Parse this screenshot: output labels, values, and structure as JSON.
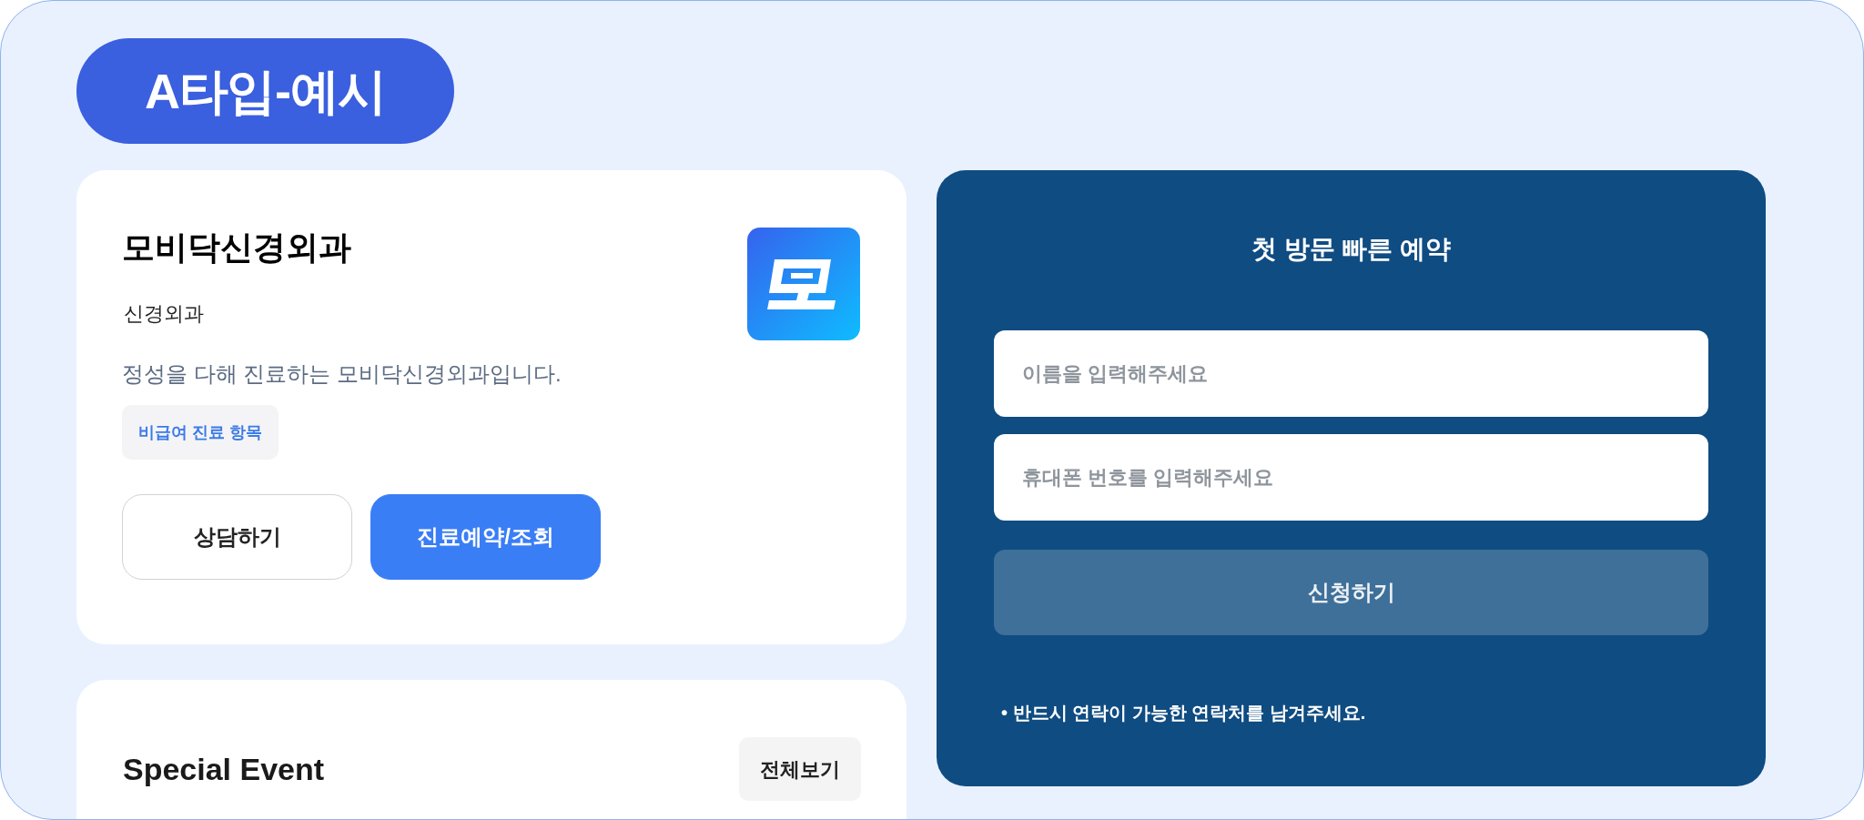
{
  "badge": {
    "label": "A타입-예시"
  },
  "clinic_card": {
    "name": "모비닥신경외과",
    "department": "신경외과",
    "description": "정성을 다해 진료하는 모비닥신경외과입니다.",
    "tags": [
      "비급여 진료 항목"
    ],
    "buttons": [
      {
        "label": "상담하기",
        "kind": "outline"
      },
      {
        "label": "진료예약/조회",
        "kind": "primary"
      }
    ]
  },
  "event_card": {
    "title": "Special Event",
    "view_all": "전체보기"
  },
  "reservation": {
    "title": "첫 방문 빠른 예약",
    "fields": [
      {
        "placeholder": "이름을 입력해주세요"
      },
      {
        "placeholder": "휴대폰 번호를 입력해주세요"
      }
    ],
    "submit": {
      "label": "신청하기",
      "disabled": true
    },
    "note": "• 반드시 연락이 가능한 연락처를 남겨주세요."
  }
}
